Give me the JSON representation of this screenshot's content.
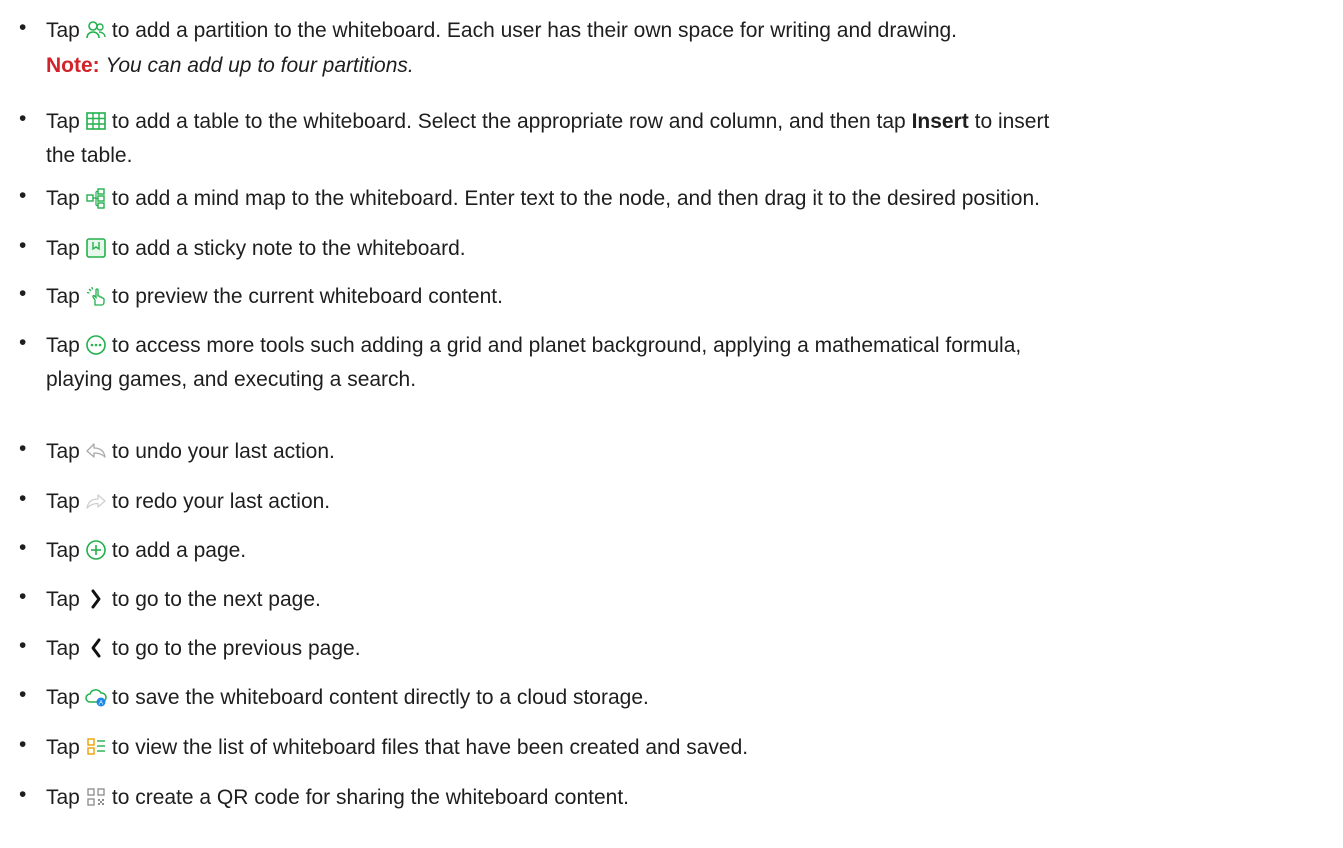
{
  "colors": {
    "text": "#1e1e1e",
    "note_label": "#d2232a",
    "icon_green": "#22b14c",
    "icon_blue": "#1e88e5"
  },
  "items": [
    {
      "icon": "partition-users-icon",
      "prefix": "Tap",
      "text": "to add a partition to the whiteboard. Each user has their own space for writing and drawing.",
      "note_label": "Note:",
      "note_text": "You can add up to four partitions."
    },
    {
      "icon": "table-grid-icon",
      "prefix": "Tap",
      "text_before_bold": "to add a table to the whiteboard. Select the appropriate row and column, and then tap",
      "bold": "Insert",
      "text_after_bold": "to insert",
      "line2": "the table."
    },
    {
      "icon": "mind-map-icon",
      "prefix": "Tap",
      "text": "to add a mind map to the whiteboard. Enter text to the node, and then drag it to the desired position."
    },
    {
      "icon": "sticky-note-icon",
      "prefix": "Tap",
      "text": "to add a sticky note to the whiteboard."
    },
    {
      "icon": "preview-hand-icon",
      "prefix": "Tap",
      "text": "to preview the current whiteboard content."
    },
    {
      "icon": "more-tools-icon",
      "prefix": "Tap",
      "text": "to access more tools such adding a grid and planet background, applying a mathematical formula,",
      "line2": "playing games, and executing a search."
    },
    {
      "icon": "undo-icon",
      "prefix": "Tap",
      "text": "to undo your last action."
    },
    {
      "icon": "redo-icon",
      "prefix": "Tap",
      "text": "to redo your last action."
    },
    {
      "icon": "add-page-icon",
      "prefix": "Tap",
      "text": "to add a page."
    },
    {
      "icon": "next-page-icon",
      "prefix": "Tap",
      "text": "to go to the next page."
    },
    {
      "icon": "previous-page-icon",
      "prefix": "Tap",
      "text": "to go to the previous page."
    },
    {
      "icon": "cloud-save-icon",
      "prefix": "Tap",
      "text": "to save the whiteboard content directly to a cloud storage."
    },
    {
      "icon": "file-list-icon",
      "prefix": "Tap",
      "text": "to view the list of whiteboard files that have been created and saved."
    },
    {
      "icon": "qr-code-icon",
      "prefix": "Tap",
      "text": "to create a QR code for sharing the whiteboard content."
    }
  ]
}
